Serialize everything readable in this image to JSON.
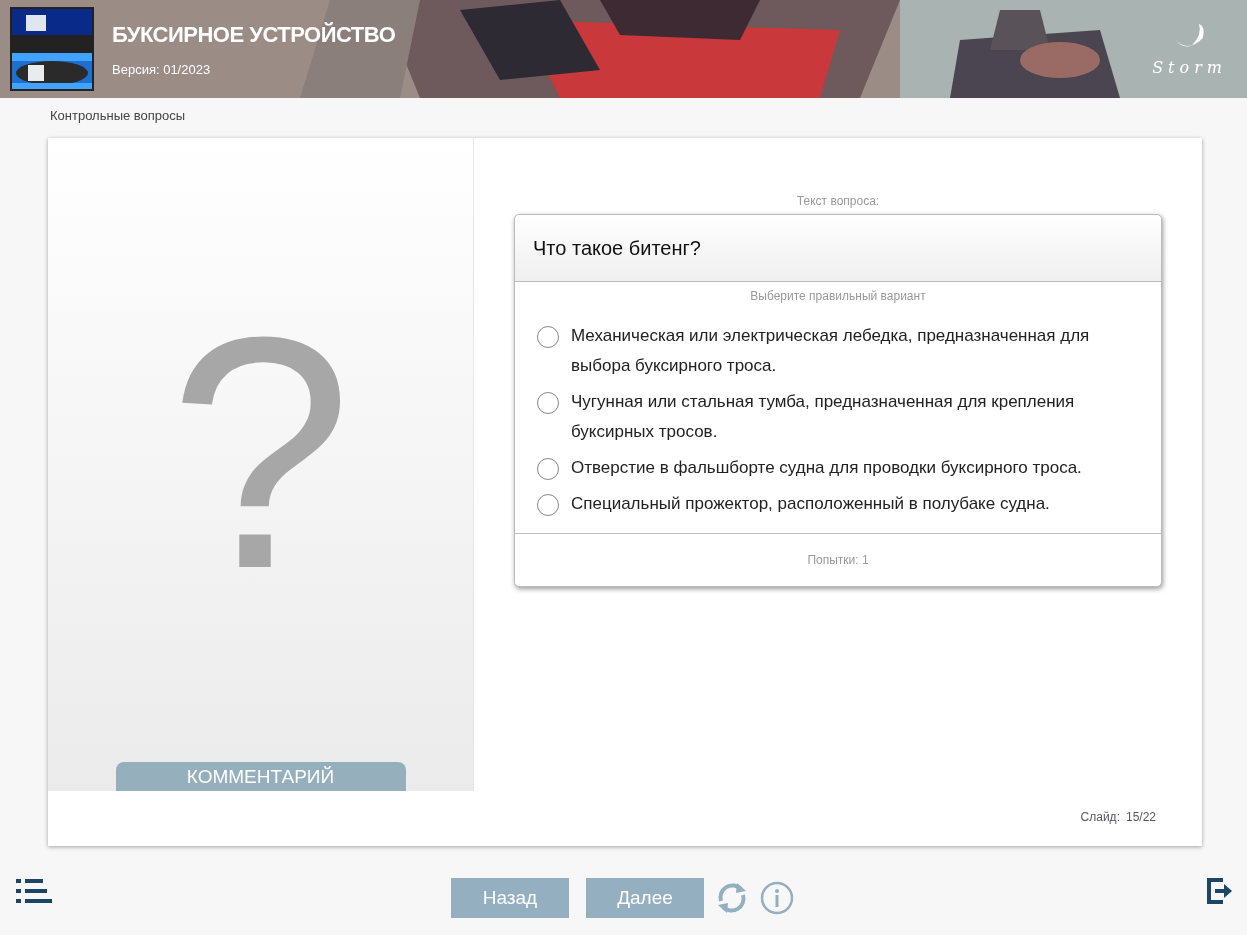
{
  "header": {
    "title": "БУКСИРНОЕ УСТРОЙСТВО",
    "version": "Версия: 01/2023",
    "logo_text": "Storm"
  },
  "breadcrumb": "Контрольные вопросы",
  "left_panel": {
    "symbol": "?",
    "comment_button": "КОММЕНТАРИЙ"
  },
  "question": {
    "caption": "Текст вопроса:",
    "text": "Что такое битенг?",
    "instruction": "Выберите правильный вариант",
    "options": [
      {
        "label": "Механическая или электрическая лебедка, предназначенная для выбора буксирного троса.",
        "selected": false
      },
      {
        "label": "Чугунная или стальная тумба, предназначенная для крепления буксирных тросов.",
        "selected": false
      },
      {
        "label": "Отверстие в фальшборте судна для проводки буксирного троса.",
        "selected": false
      },
      {
        "label": "Специальный прожектор, расположенный в полубаке судна.",
        "selected": false
      }
    ],
    "attempts": "Попытки: 1"
  },
  "slide": {
    "label": "Слайд:",
    "value": "15/22"
  },
  "footer": {
    "buttons": [
      "Назад",
      "Далее"
    ]
  }
}
